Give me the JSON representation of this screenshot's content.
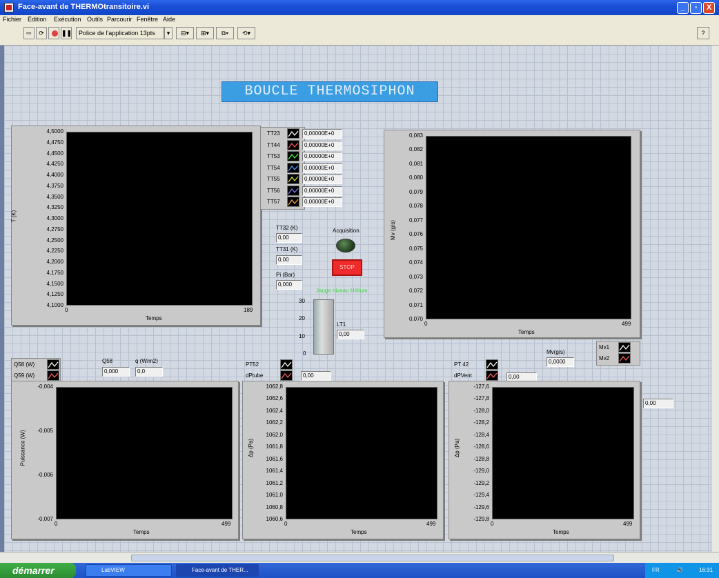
{
  "window": {
    "title": "Face-avant de THERMOtransitoire.vi",
    "buttons": [
      "_",
      "▫",
      "X"
    ]
  },
  "menu": [
    "Fichier",
    "Édition",
    "Exécution",
    "Outils",
    "Parcourir",
    "Fenêtre",
    "Aide"
  ],
  "toolbar": {
    "font_select": "Police de l'application 13pts"
  },
  "banner": "BOUCLE THERMOSIPHON",
  "temp_graph": {
    "ylabel": "T (K)",
    "xlabel": "Temps",
    "yticks": [
      "4,5000",
      "4,4750",
      "4,4500",
      "4,4250",
      "4,4000",
      "4,3750",
      "4,3500",
      "4,3250",
      "4,3000",
      "4,2750",
      "4,2500",
      "4,2250",
      "4,2000",
      "4,1750",
      "4,1500",
      "4,1250",
      "4,1000"
    ],
    "xticks": [
      "0",
      "189"
    ]
  },
  "temp_legend": [
    {
      "name": "TT23",
      "value": "0,00000E+0",
      "color": "#ffffff"
    },
    {
      "name": "TT44",
      "value": "0,00000E+0",
      "color": "#ff5a5a"
    },
    {
      "name": "TT53",
      "value": "0,00000E+0",
      "color": "#3cff3c"
    },
    {
      "name": "TT54",
      "value": "0,00000E+0",
      "color": "#3c9eff"
    },
    {
      "name": "TT55",
      "value": "0,00000E+0",
      "color": "#dddd3c"
    },
    {
      "name": "TT56",
      "value": "0,00000E+0",
      "color": "#7a7aff"
    },
    {
      "name": "TT57",
      "value": "0,00000E+0",
      "color": "#ffa23c"
    }
  ],
  "controls": {
    "tt32_label": "TT32 (K)",
    "tt32_value": "0,00",
    "tt31_label": "TT31 (K)",
    "tt31_value": "0,00",
    "pi_label": "Pi (Bar)",
    "pi_value": "0,000",
    "acquisition_label": "Acquisition",
    "stop_label": "STOP",
    "tank_caption": "Jauge niveau Hélium",
    "tank_ticks": [
      "30",
      "20",
      "10",
      "0"
    ],
    "lt1_label": "LT1",
    "lt1_value": "0,00"
  },
  "mv_graph": {
    "ylabel": "Mv (g/s)",
    "xlabel": "Temps",
    "yticks": [
      "0,083",
      "0,082",
      "0,081",
      "0,080",
      "0,079",
      "0,078",
      "0,077",
      "0,076",
      "0,075",
      "0,074",
      "0,073",
      "0,072",
      "0,071",
      "0,070"
    ],
    "xticks": [
      "0",
      "499"
    ],
    "mv_label": "Mv(g/s)",
    "mv_value": "0,0000",
    "legend": [
      {
        "name": "Mv1",
        "color": "#ffffff"
      },
      {
        "name": "Mv2",
        "color": "#ff5a5a"
      }
    ]
  },
  "power_graph": {
    "legend": [
      {
        "name": "Q58 (W)",
        "color": "#ffffff"
      },
      {
        "name": "Q59 (W)",
        "color": "#ff5a5a"
      }
    ],
    "q58_label": "Q58",
    "q58_value": "0,000",
    "q_label": "q (W/m2)",
    "q_value": "0,0",
    "ylabel": "Puissance (W)",
    "xlabel": "Temps",
    "yticks": [
      "-0,004",
      "-0,005",
      "-0,006",
      "-0,007"
    ],
    "xticks": [
      "0",
      "499"
    ]
  },
  "dp_tube_graph": {
    "legend": [
      {
        "name": "PT52",
        "color": "#ffffff"
      },
      {
        "name": "dPtube",
        "color": "#ff5a5a"
      }
    ],
    "value": "0,00",
    "ylabel": "Δp (Pa)",
    "xlabel": "Temps",
    "yticks": [
      "1062,8",
      "1062,6",
      "1062,4",
      "1062,2",
      "1062,0",
      "1061,8",
      "1061,6",
      "1061,4",
      "1061,2",
      "1061,0",
      "1060,8",
      "1060,6"
    ],
    "xticks": [
      "0",
      "499"
    ]
  },
  "dp_vent_graph": {
    "legend": [
      {
        "name": "PT 42",
        "color": "#ffffff"
      },
      {
        "name": "dPVent",
        "color": "#ff5a5a"
      }
    ],
    "value": "0,00",
    "side_value": "0,00",
    "ylabel": "Δp (Pa)",
    "xlabel": "Temps",
    "yticks": [
      "-127,6",
      "-127,8",
      "-128,0",
      "-128,2",
      "-128,4",
      "-128,6",
      "-128,8",
      "-129,0",
      "-129,2",
      "-129,4",
      "-129,6",
      "-129,8"
    ],
    "xticks": [
      "0",
      "499"
    ]
  },
  "taskbar": {
    "start": "démarrer",
    "tasks": [
      "LabVIEW",
      "Face-avant de THER..."
    ],
    "lang": "FR",
    "clock": "16:31"
  }
}
